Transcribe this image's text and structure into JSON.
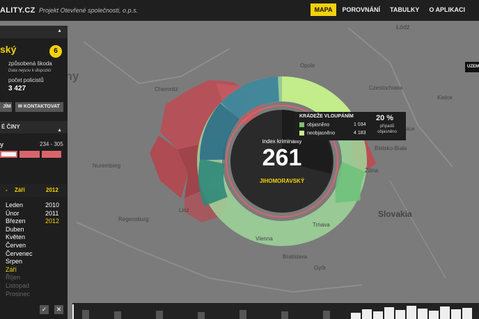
{
  "header": {
    "brand": "ALITY.CZ",
    "tagline": "Projekt Otevřené společnosti, o.p.s.",
    "nav": [
      {
        "label": "MAPA",
        "active": true
      },
      {
        "label": "POROVNÁNÍ",
        "active": false
      },
      {
        "label": "TABULKY",
        "active": false
      },
      {
        "label": "O APLIKACI",
        "active": false
      },
      {
        "label": "",
        "active": false
      }
    ]
  },
  "sidebar": {
    "region_name": "ský",
    "rank": "6",
    "damage_label": "způsobená škoda",
    "damage_note": "Data nejsou k dispozici",
    "police_label": "počet policistů",
    "police_value": "3 427",
    "share_button": "JÍM",
    "contact_button": "KONTAKTOVAT",
    "crimes_header": "É ČINY",
    "filter_label": "y",
    "filter_range": "234 - 305",
    "period_header_month": "Září",
    "period_header_year": "2012",
    "months": [
      {
        "m": "Leden",
        "y": "2010"
      },
      {
        "m": "Únor",
        "y": "2011"
      },
      {
        "m": "Březen",
        "y": "2012"
      },
      {
        "m": "Duben",
        "y": ""
      },
      {
        "m": "Květen",
        "y": ""
      },
      {
        "m": "Červen",
        "y": ""
      },
      {
        "m": "Červenec",
        "y": ""
      },
      {
        "m": "Srpen",
        "y": ""
      },
      {
        "m": "Září",
        "y": ""
      },
      {
        "m": "Říjen",
        "y": ""
      },
      {
        "m": "Listopad",
        "y": ""
      },
      {
        "m": "Prosinec",
        "y": ""
      }
    ],
    "confirm_icon": "check-icon",
    "cancel_icon": "close-icon"
  },
  "map_labels": {
    "many": "any",
    "chemnitz": "Chemnitz",
    "nuremberg": "Nuremberg",
    "regensburg": "Regensburg",
    "lodz": "Łódź",
    "czestochowa": "Czestochowa",
    "kielce": "Kielce",
    "katowice": "Katowice",
    "bielsko": "Bielsko-Biała",
    "slovakia": "Slovakia",
    "vienna": "Vienna",
    "bratislava": "Bratislava",
    "linz": "Linz",
    "gyor": "Győr",
    "zilina": "Žilina",
    "trnava": "Trnava",
    "opole": "Opole"
  },
  "donut": {
    "center_title": "index kriminality",
    "center_value": "261",
    "region": "JIHOMORAVSKÝ"
  },
  "tooltip": {
    "title": "KRÁDEŽE VLOUPÁNÍM",
    "solved_label": "objasněno",
    "solved_value": "1 034",
    "unsolved_label": "neobjasněno",
    "unsolved_value": "4 183",
    "percent": "20 %",
    "percent_note_1": "případů",
    "percent_note_2": "objasněno"
  },
  "right_button": "UZEM",
  "colors": {
    "accent": "#f3d10c",
    "region_red": "#c04a52",
    "green_light": "#8fd18a",
    "teal": "#2e7f86"
  }
}
